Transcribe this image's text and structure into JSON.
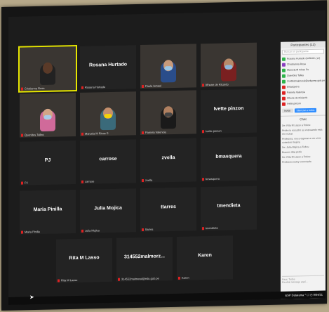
{
  "participants_panel": {
    "title": "Participantes (13)",
    "search_placeholder": "Buscar un participante",
    "items": [
      {
        "name": "Rosana Hurtado (Anfitrión, yo)",
        "color": "#2db34a"
      },
      {
        "name": "Christianna Rosa",
        "color": "#8a3fc0"
      },
      {
        "name": "Marcela M Rivas Se",
        "color": "#2db34a"
      },
      {
        "name": "Querides Tallas",
        "color": "#2db34a"
      },
      {
        "name": "314552malmoral@eduprep.gob.pe",
        "color": "#2db34a"
      },
      {
        "name": "bmasquera",
        "color": "#d22"
      },
      {
        "name": "Pamela Valencia",
        "color": "#d22"
      },
      {
        "name": "Iñhone de Riciardo",
        "color": "#d22"
      },
      {
        "name": "Ivette pinzon",
        "color": "#d22"
      }
    ],
    "invite_label": "Invitar",
    "mute_all_label": "Silenciar a todos"
  },
  "chat_panel": {
    "title": "Chat",
    "messages": [
      "De: Rita M Lasso a Todos:",
      "Profe no escucho su vozcuando esta en el chat",
      "Profesora, voy a esperar a ver si mi conexion mejora",
      "De: Julia Mojica a Todos:",
      "Buenos dias profe",
      "De: Rita M Lasso a Todos:",
      "Profesora estoy conectada"
    ],
    "to_label": "Para: Todos",
    "input_placeholder": "Escribir mensaje aquí..."
  },
  "tiles": [
    {
      "label": "Cristianna Rosa",
      "big": "",
      "video": true,
      "active": true,
      "skin": "#5a3a28",
      "shirt": "#222"
    },
    {
      "label": "Rosana Hurtado",
      "big": "Rosana Hurtado",
      "video": false
    },
    {
      "label": "Paula Ismael",
      "big": "",
      "video": true,
      "skin": "#c89a7a",
      "shirt": "#2a4d8a",
      "mask": "#9cc7e6"
    },
    {
      "label": "Iñhone de Ricardo",
      "big": "",
      "video": true,
      "skin": "#b88a6a",
      "shirt": "#7a2020",
      "mask": "#8fb6da"
    },
    {
      "label": "Querides Tallas",
      "big": "",
      "video": true,
      "skin": "#d3a586",
      "shirt": "#d06a9a",
      "mask": "#a8cbe8"
    },
    {
      "label": "Marcela M Rivas S",
      "big": "",
      "video": true,
      "skin": "#c48f6c",
      "shirt": "#3a6a7a",
      "mask": "#f2d20a"
    },
    {
      "label": "Pamela Valencia",
      "big": "",
      "video": true,
      "skin": "#b08060",
      "shirt": "#1a1a1a",
      "mask": "#444"
    },
    {
      "label": "Ivette pinzon",
      "big": "Ivette pinzon",
      "video": false
    },
    {
      "label": "PJ",
      "big": "PJ",
      "video": false
    },
    {
      "label": "carrose",
      "big": "carrose",
      "video": false
    },
    {
      "label": "zvella",
      "big": "zvella",
      "video": false
    },
    {
      "label": "bmasquera",
      "big": "bmasquera",
      "video": false
    },
    {
      "label": "Maria Pinilla",
      "big": "Maria Pinilla",
      "video": false
    },
    {
      "label": "Julia Mojica",
      "big": "Julia Mojica",
      "video": false
    },
    {
      "label": "ttarres",
      "big": "ttarres",
      "video": false
    },
    {
      "label": "tmendieta",
      "big": "tmendieta",
      "video": false
    },
    {
      "label": "Rita M Lasso",
      "big": "Rita M Lasso",
      "video": false
    },
    {
      "label": "314552malmoral@edu.gob.pe",
      "big": "314552malmorz...",
      "video": false
    },
    {
      "label": "Karen",
      "big": "Karen",
      "video": false
    }
  ],
  "taskbar": {
    "tray_text": "ESP  Datarama  ^  ☐  ◷  9/04/21"
  }
}
